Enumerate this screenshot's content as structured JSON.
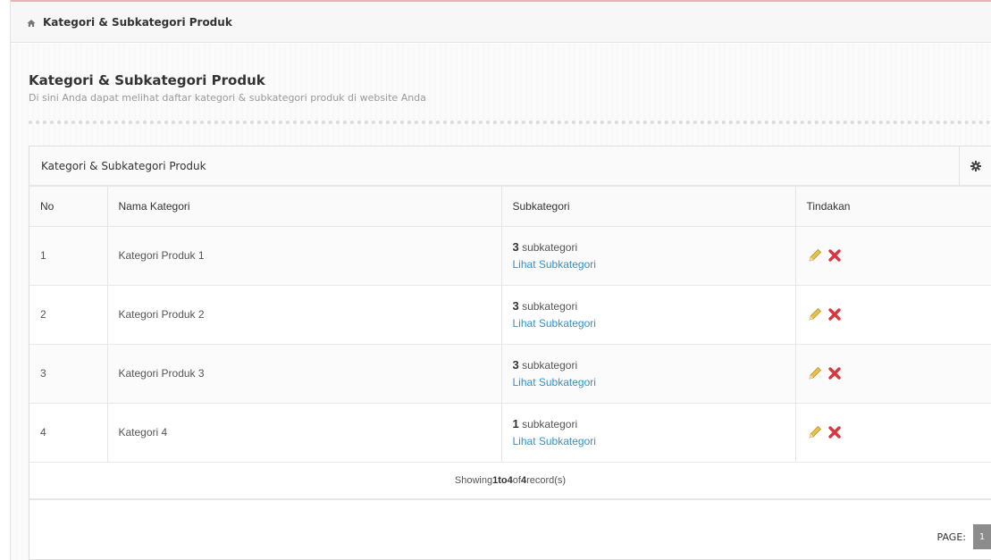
{
  "breadcrumb": {
    "label": "Kategori & Subkategori Produk"
  },
  "header": {
    "title": "Kategori & Subkategori Produk",
    "subtitle": "Di sini Anda dapat melihat daftar kategori & subkategori produk di website Anda"
  },
  "panel": {
    "title": "Kategori & Subkategori Produk"
  },
  "table": {
    "columns": [
      "No",
      "Nama Kategori",
      "Subkategori",
      "Tindakan"
    ],
    "rows": [
      {
        "no": "1",
        "name": "Kategori Produk 1",
        "count": "3",
        "count_suffix": " subkategori",
        "link": "Lihat Subkategori"
      },
      {
        "no": "2",
        "name": "Kategori Produk 2",
        "count": "3",
        "count_suffix": " subkategori",
        "link": "Lihat Subkategori"
      },
      {
        "no": "3",
        "name": "Kategori Produk 3",
        "count": "3",
        "count_suffix": " subkategori",
        "link": "Lihat Subkategori"
      },
      {
        "no": "4",
        "name": "Kategori 4",
        "count": "1",
        "count_suffix": " subkategori",
        "link": "Lihat Subkategori"
      }
    ]
  },
  "footer": {
    "prefix": "Showing ",
    "from": "1",
    "to_word": " to ",
    "to": "4",
    "of_word": " of ",
    "total": "4",
    "suffix": " record(s)"
  },
  "pager": {
    "label": "PAGE:",
    "current": "1"
  },
  "icons": {
    "home": "home-icon",
    "settings": "gear-icon",
    "edit": "pencil-icon",
    "delete": "delete-x-icon"
  },
  "colors": {
    "link": "#3a8fc5",
    "delete": "#d9363e",
    "edit": "#d4a017",
    "pager": "#8c8c8c"
  }
}
